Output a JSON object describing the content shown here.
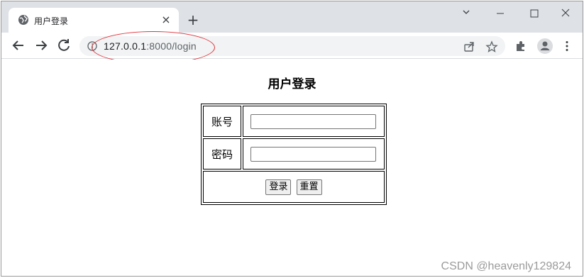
{
  "browser": {
    "tab": {
      "title": "用户登录",
      "close": "×"
    },
    "new_tab": "+",
    "url": {
      "host": "127.0.0.1",
      "rest": ":8000/login"
    }
  },
  "page": {
    "heading": "用户登录",
    "form": {
      "account_label": "账号",
      "account_value": "",
      "password_label": "密码",
      "password_value": "",
      "login_label": "登录",
      "reset_label": "重置"
    }
  },
  "watermark": "CSDN @heavenly129824",
  "colors": {
    "tabstrip": "#dee1e6",
    "annotation": "#e0323a"
  }
}
